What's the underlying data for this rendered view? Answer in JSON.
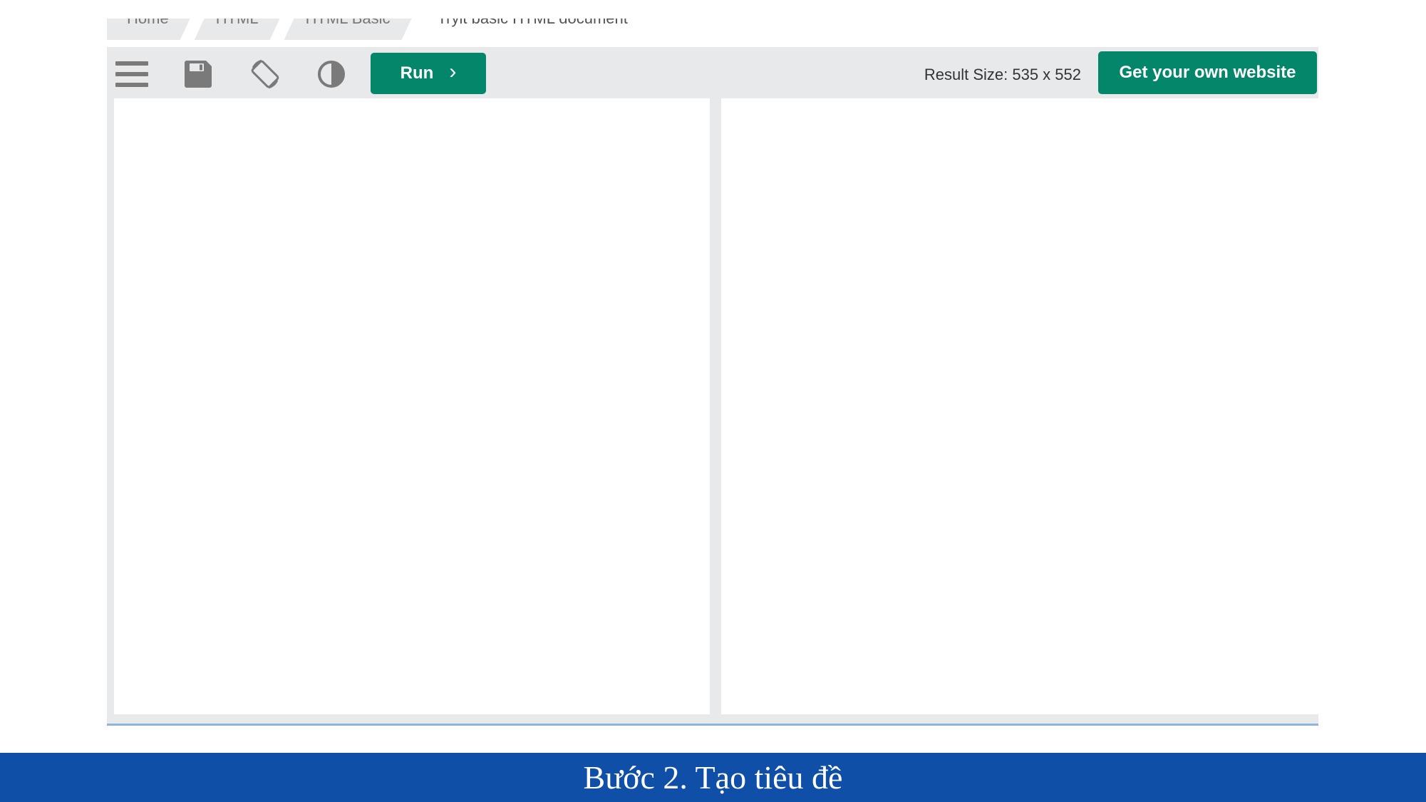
{
  "breadcrumb": {
    "items": [
      "Home",
      "HTML",
      "HTML Basic",
      "Tryit basic HTML document"
    ]
  },
  "toolbar": {
    "icons": [
      "menu-icon",
      "save-icon",
      "rotate-icon",
      "contrast-icon"
    ],
    "run_label": "Run",
    "run_chevron": "›",
    "result_size": "Result Size: 535 x 552",
    "own_website_label": "Get your own website"
  },
  "editor": {
    "code_text": "",
    "result_text": ""
  },
  "caption": {
    "text": "Bước 2. Tạo tiêu đề"
  },
  "colors": {
    "accent": "#04866a",
    "toolbar_bg": "#e7e9eb",
    "icon_gray": "#7a7a7a",
    "caption_bg": "#0f4fa8"
  }
}
